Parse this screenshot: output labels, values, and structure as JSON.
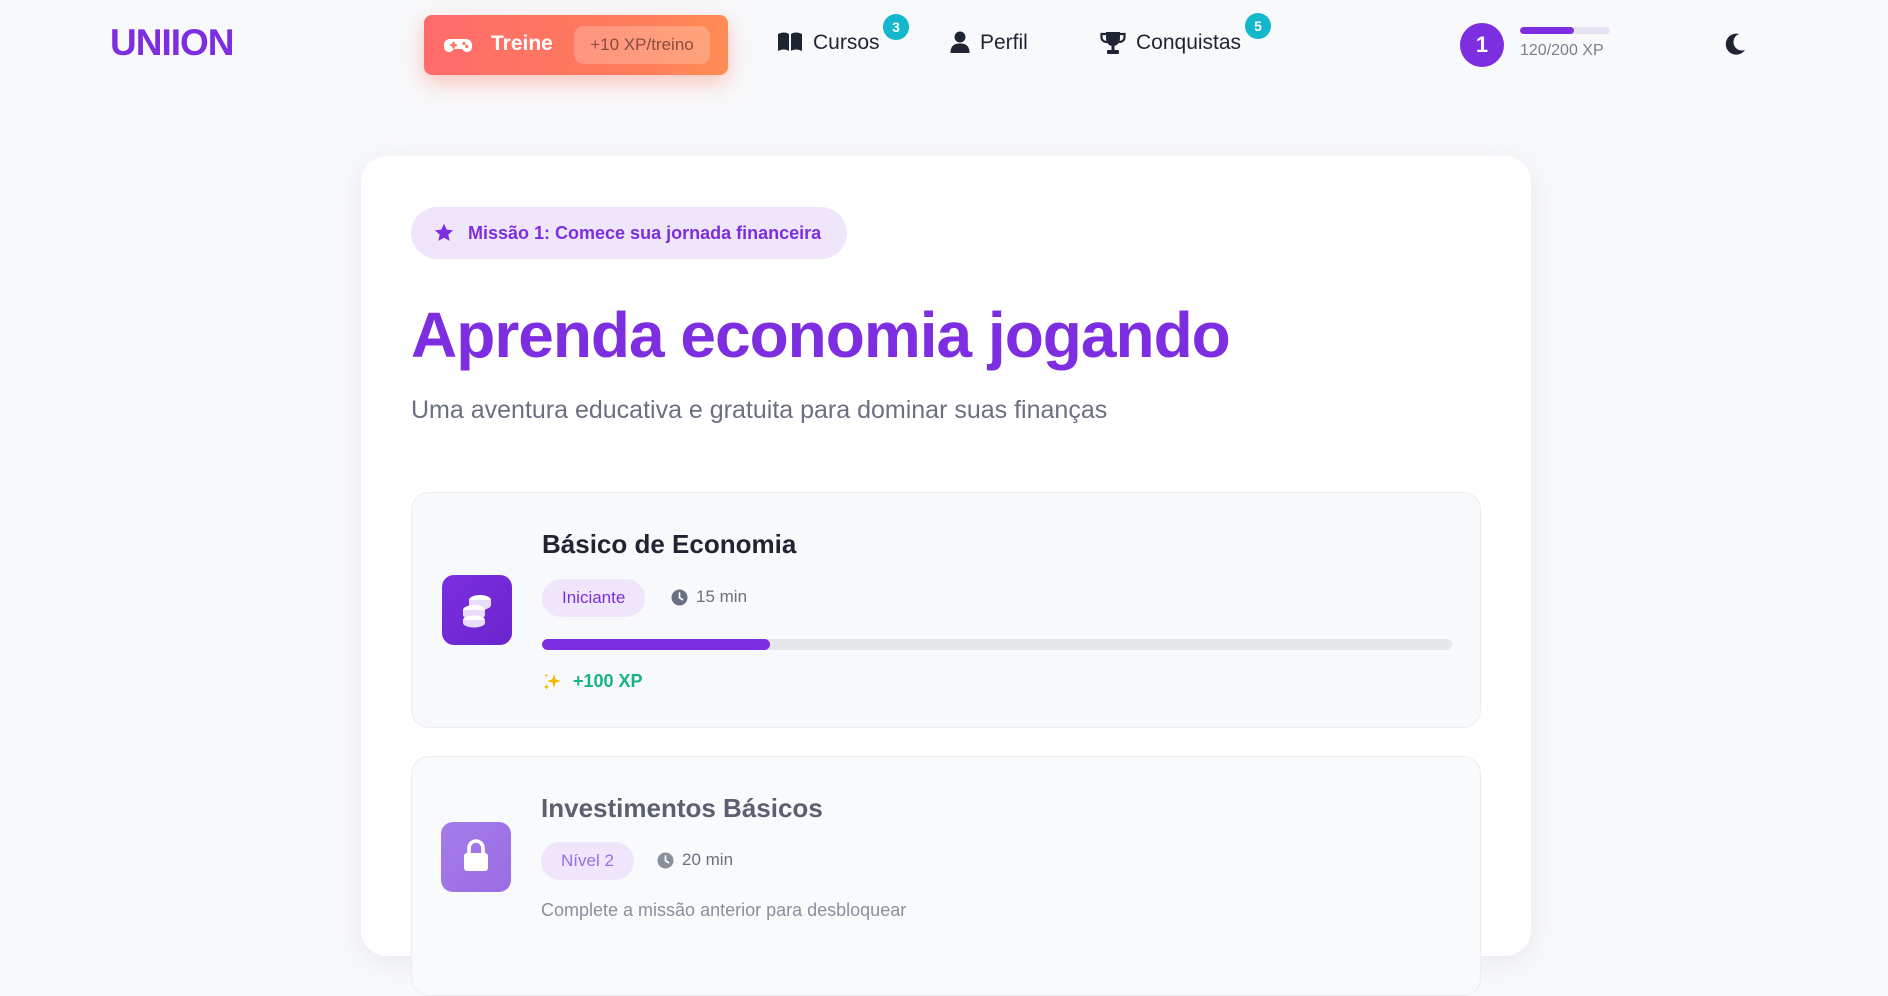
{
  "brand": {
    "logo": "UNIION",
    "accent": "#7c2ee0"
  },
  "nav": {
    "train": {
      "label": "Treine",
      "reward": "+10 XP/treino",
      "icon": "gamepad-icon"
    },
    "courses": {
      "label": "Cursos",
      "badge": "3",
      "icon": "book-open-icon"
    },
    "profile": {
      "label": "Perfil",
      "icon": "user-icon"
    },
    "achievements": {
      "label": "Conquistas",
      "badge": "5",
      "icon": "trophy-icon"
    }
  },
  "user": {
    "level": "1",
    "xp_text": "120/200 XP",
    "xp_progress": 0.6
  },
  "theme_toggle": {
    "icon": "moon-icon"
  },
  "hero": {
    "mission_chip": "Missão 1: Comece sua jornada financeira",
    "title": "Aprenda economia jogando",
    "subtitle": "Uma aventura educativa e gratuita para dominar suas finanças"
  },
  "courses": [
    {
      "title": "Básico de Economia",
      "level": "Iniciante",
      "duration": "15 min",
      "progress": 0.25,
      "reward": "+100 XP",
      "icon": "coins-icon",
      "locked": false
    },
    {
      "title": "Investimentos Básicos",
      "level": "Nível 2",
      "duration": "20 min",
      "lock_note": "Complete a missão anterior para desbloquear",
      "icon": "lock-icon",
      "locked": true
    }
  ],
  "colors": {
    "primary": "#7c2ee0",
    "train_gradient_start": "#ff6b6b",
    "train_gradient_end": "#ff8c55",
    "badge": "#14b8cc",
    "reward": "#17b385"
  }
}
